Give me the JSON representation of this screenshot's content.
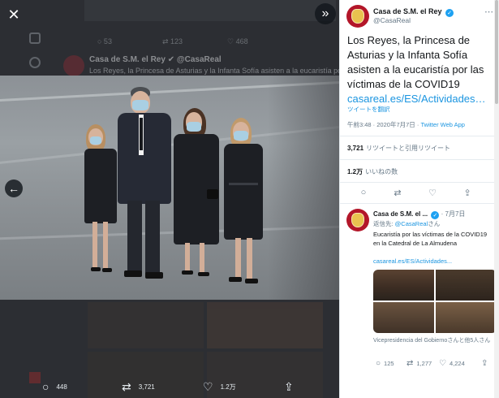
{
  "background_feed": {
    "account_name": "Casa de S.M. el Rey",
    "account_handle": "@CasaReal",
    "snippet": "Los Reyes, la Princesa de Asturias y la Infanta Sofía asisten a la eucaristía por las"
  },
  "viewer": {
    "close_icon": "close-icon",
    "expand_icon": "chevron-double-right-icon",
    "prev_icon": "arrow-left-icon",
    "actions": {
      "reply_count": "448",
      "retweet_count": "3,721",
      "like_count": "1.2万"
    }
  },
  "tweet": {
    "account_name": "Casa de S.M. el Rey",
    "account_handle": "@CasaReal",
    "text": "Los Reyes, la Princesa de Asturias y la Infanta Sofía asisten a la eucaristía por las víctimas de la COVID19",
    "link": "casareal.es/ES/Actividades…",
    "translate": "ツイートを翻訳",
    "time": "午前3:48 · 2020年7月7日",
    "source": "Twitter Web App",
    "retweets_count": "3,721",
    "retweets_label": "リツイートと引用リツイート",
    "likes_count": "1.2万",
    "likes_label": "いいねの数"
  },
  "reply": {
    "account_name": "Casa de S.M. el ...",
    "date": "7月7日",
    "reply_to_prefix": "返信先: ",
    "reply_to_mention": "@CasaReal",
    "reply_to_suffix": "さん",
    "text": "Eucaristía por las víctimas de la COVID19 en la Catedral de La Almudena",
    "link": "casareal.es/ES/Actividades...",
    "caption": "Vicepresidencia del Gobiernoさんと他5人さん",
    "reply_count": "125",
    "retweet_count": "1,277",
    "like_count": "4,224"
  },
  "colors": {
    "accent": "#1da1f2",
    "link": "#1b95e0",
    "brand_red": "#b31629"
  }
}
